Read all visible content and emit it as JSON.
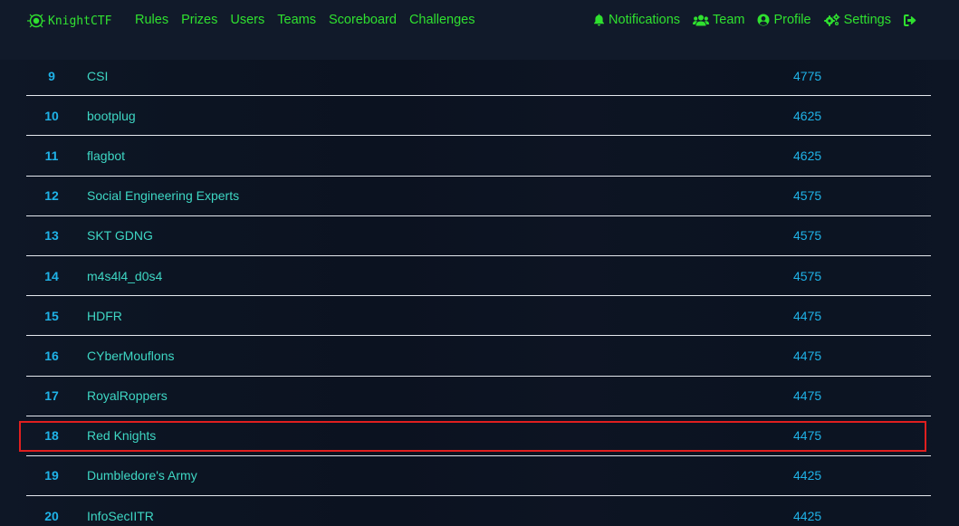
{
  "brand": {
    "name": "KnightCTF"
  },
  "nav": {
    "left": [
      "Rules",
      "Prizes",
      "Users",
      "Teams",
      "Scoreboard",
      "Challenges"
    ],
    "right": {
      "notifications": "Notifications",
      "team": "Team",
      "profile": "Profile",
      "settings": "Settings"
    }
  },
  "colors": {
    "nav_green": "#2fe02f",
    "rank_blue": "#1fb3e8",
    "name_teal": "#3ed7c4",
    "highlight_red": "#e01f1f",
    "background": "#0d1524"
  },
  "scoreboard": {
    "rows": [
      {
        "rank": "9",
        "team": "CSI",
        "score": "4775"
      },
      {
        "rank": "10",
        "team": "bootplug",
        "score": "4625"
      },
      {
        "rank": "11",
        "team": "flagbot",
        "score": "4625"
      },
      {
        "rank": "12",
        "team": "Social Engineering Experts",
        "score": "4575"
      },
      {
        "rank": "13",
        "team": "SKT GDNG",
        "score": "4575"
      },
      {
        "rank": "14",
        "team": "m4s4l4_d0s4",
        "score": "4575"
      },
      {
        "rank": "15",
        "team": "HDFR",
        "score": "4475"
      },
      {
        "rank": "16",
        "team": "CYberMouflons",
        "score": "4475"
      },
      {
        "rank": "17",
        "team": "RoyalRoppers",
        "score": "4475"
      },
      {
        "rank": "18",
        "team": "Red Knights",
        "score": "4475"
      },
      {
        "rank": "19",
        "team": "Dumbledore's Army",
        "score": "4425"
      },
      {
        "rank": "20",
        "team": "InfoSecIITR",
        "score": "4425"
      }
    ],
    "highlighted_rank": "18"
  }
}
